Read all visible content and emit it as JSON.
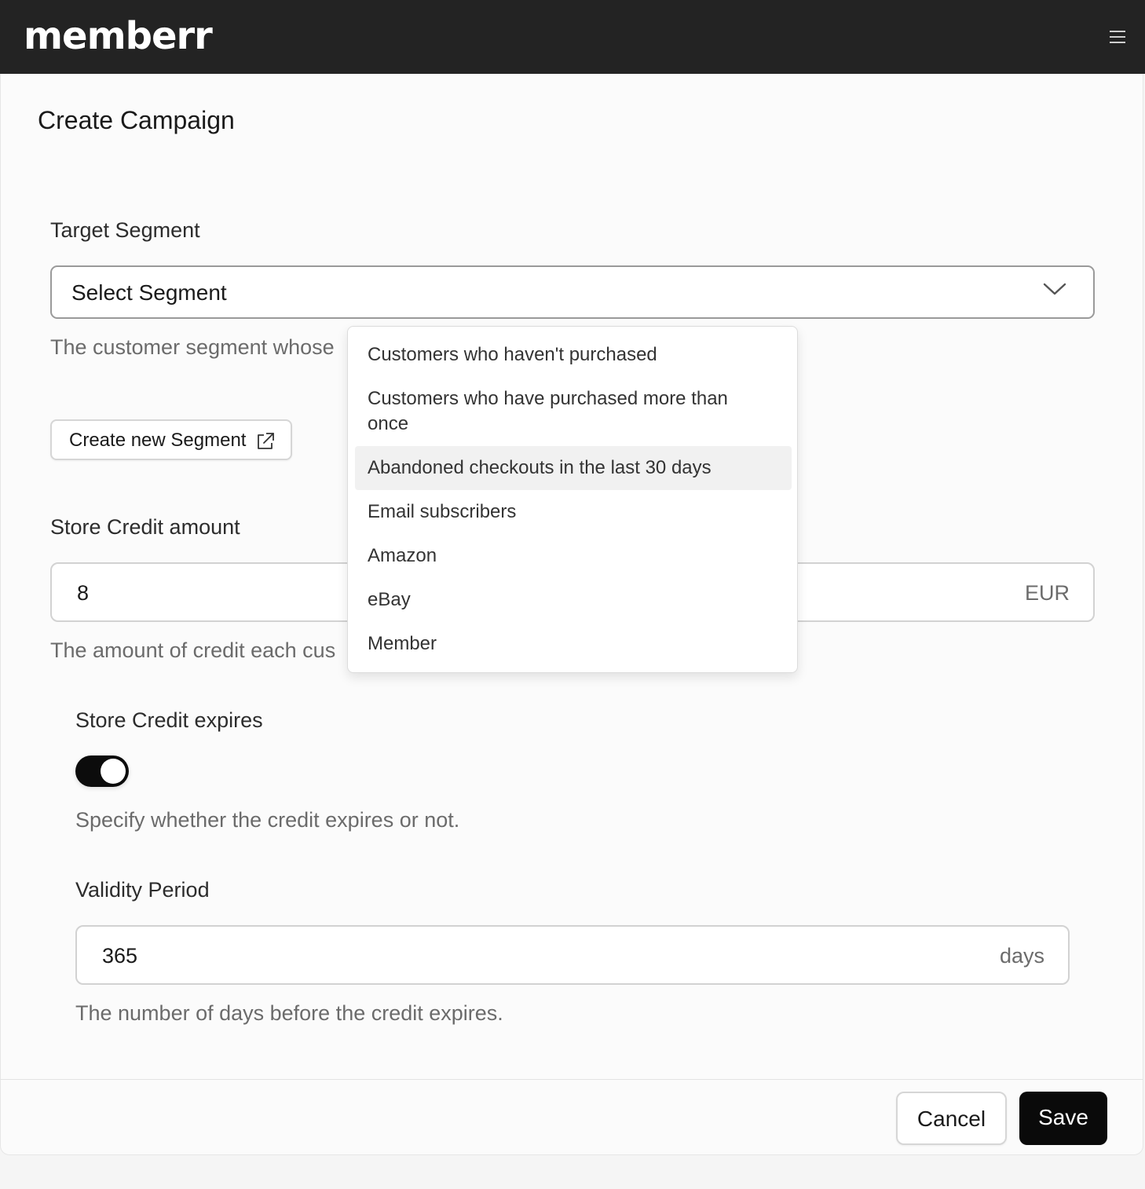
{
  "app": {
    "logo_text": "memberr",
    "menu_icon": "hamburger-menu-icon"
  },
  "page": {
    "title": "Create Campaign"
  },
  "segment": {
    "label": "Target Segment",
    "selected": "Select Segment",
    "help": "The customer segment whose",
    "create_button": "Create new Segment",
    "create_icon": "external-link-icon",
    "dropdown_options": [
      "Customers who haven't purchased",
      "Customers who have purchased more than once",
      "Abandoned checkouts in the last 30 days",
      "Email subscribers",
      "Amazon",
      "eBay",
      "Member"
    ],
    "highlighted_option": "Abandoned checkouts in the last 30 days"
  },
  "credit": {
    "label": "Store Credit amount",
    "value": "8",
    "suffix": "EUR",
    "help": "The amount of credit each cus"
  },
  "expires": {
    "label": "Store Credit expires",
    "enabled": true,
    "help": "Specify whether the credit expires or not."
  },
  "validity": {
    "label": "Validity Period",
    "value": "365",
    "suffix": "days",
    "help": "The number of days before the credit expires."
  },
  "footer": {
    "cancel_label": "Cancel",
    "save_label": "Save"
  },
  "colors": {
    "topbar": "#232323",
    "primary_button": "#0a0a0a",
    "toggle_on": "#0c0c0c"
  }
}
